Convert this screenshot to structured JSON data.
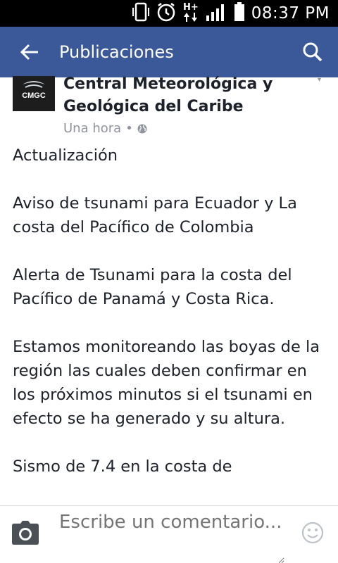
{
  "status_bar": {
    "time": "08:37 PM",
    "network": "H+",
    "icons": [
      "vibrate-icon",
      "alarm-icon",
      "data-hplus-icon",
      "signal-icon",
      "battery-icon"
    ]
  },
  "app_bar": {
    "title": "Publicaciones",
    "background": "#3b5998"
  },
  "post": {
    "author_line1": "Central Meteorológica y",
    "author_line2": "Geológica del Caribe",
    "logo_text": "CMGC",
    "time": "Una hora",
    "separator": "•",
    "privacy_icon": "globe-icon",
    "body": [
      "Actualización",
      "Aviso de tsunami para Ecuador y La costa del Pacífico de Colombia",
      "Alerta de Tsunami para la costa del Pacífico de Panamá y Costa Rica.",
      "Estamos monitoreando las boyas de la región las cuales deben confirmar en los próximos minutos si el tsunami en efecto se ha generado y su altura.",
      "Sismo de 7.4 en la costa de"
    ]
  },
  "comment_bar": {
    "placeholder": "Escribe un comentario...",
    "camera_icon": "camera-icon",
    "emoji_icon": "smiley-icon"
  }
}
